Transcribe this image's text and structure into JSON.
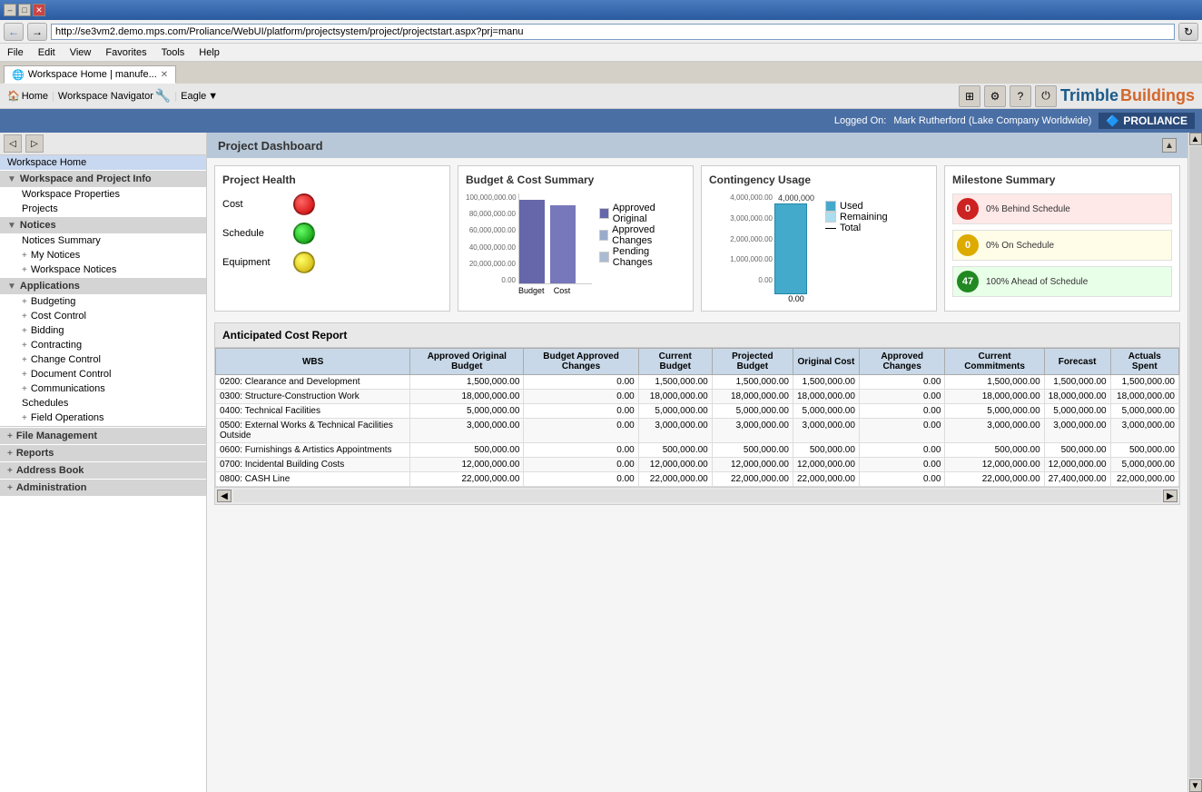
{
  "browser": {
    "url": "http://se3vm2.demo.mps.com/Proliance/WebUI/platform/projectsystem/project/projectstart.aspx?prj=manu",
    "tab_title": "Workspace Home | manufe...",
    "window_buttons": [
      "minimize",
      "maximize",
      "close"
    ],
    "menu_items": [
      "File",
      "Edit",
      "View",
      "Favorites",
      "Tools",
      "Help"
    ]
  },
  "app_header": {
    "home_label": "Home",
    "workspace_nav_label": "Workspace Navigator",
    "eagle_label": "Eagle",
    "logo": "Trimble Buildings"
  },
  "top_bar": {
    "logged_on_label": "Logged On:",
    "user": "Mark Rutherford (Lake Company Worldwide)",
    "proliance_label": "PROLIANCE"
  },
  "sidebar": {
    "header": "Workspace Home",
    "items": [
      {
        "id": "workspace-home",
        "label": "Workspace Home",
        "level": 0,
        "type": "header"
      },
      {
        "id": "workspace-project-info",
        "label": "Workspace and Project Info",
        "level": 0,
        "type": "section",
        "expanded": true
      },
      {
        "id": "workspace-properties",
        "label": "Workspace Properties",
        "level": 1
      },
      {
        "id": "projects",
        "label": "Projects",
        "level": 1
      },
      {
        "id": "notices",
        "label": "Notices",
        "level": 0,
        "type": "section",
        "expanded": true
      },
      {
        "id": "notices-summary",
        "label": "Notices Summary",
        "level": 1
      },
      {
        "id": "my-notices",
        "label": "My Notices",
        "level": 1,
        "expandable": true
      },
      {
        "id": "workspace-notices",
        "label": "Workspace Notices",
        "level": 1,
        "expandable": true
      },
      {
        "id": "applications",
        "label": "Applications",
        "level": 0,
        "type": "section",
        "expanded": true
      },
      {
        "id": "budgeting",
        "label": "Budgeting",
        "level": 1,
        "expandable": true
      },
      {
        "id": "cost-control",
        "label": "Cost Control",
        "level": 1,
        "expandable": true
      },
      {
        "id": "bidding",
        "label": "Bidding",
        "level": 1,
        "expandable": true
      },
      {
        "id": "contracting",
        "label": "Contracting",
        "level": 1,
        "expandable": true
      },
      {
        "id": "change-control",
        "label": "Change Control",
        "level": 1,
        "expandable": true
      },
      {
        "id": "document-control",
        "label": "Document Control",
        "level": 1,
        "expandable": true
      },
      {
        "id": "communications",
        "label": "Communications",
        "level": 1,
        "expandable": true
      },
      {
        "id": "schedules",
        "label": "Schedules",
        "level": 1
      },
      {
        "id": "field-operations",
        "label": "Field Operations",
        "level": 1,
        "expandable": true
      },
      {
        "id": "file-management",
        "label": "File Management",
        "level": 0,
        "type": "section",
        "expandable": true
      },
      {
        "id": "reports",
        "label": "Reports",
        "level": 0,
        "type": "section",
        "expandable": true
      },
      {
        "id": "address-book",
        "label": "Address Book",
        "level": 0,
        "type": "section",
        "expandable": true
      },
      {
        "id": "administration",
        "label": "Administration",
        "level": 0,
        "type": "section",
        "expandable": true
      }
    ]
  },
  "content": {
    "title": "Project Dashboard",
    "project_health": {
      "title": "Project Health",
      "rows": [
        {
          "label": "Cost",
          "status": "red"
        },
        {
          "label": "Schedule",
          "status": "green"
        },
        {
          "label": "Equipment",
          "status": "yellow"
        }
      ]
    },
    "budget_chart": {
      "title": "Budget & Cost Summary",
      "y_labels": [
        "100,000,000.00",
        "80,000,000.00",
        "60,000,000.00",
        "40,000,000.00",
        "20,000,000.00",
        "0.00"
      ],
      "x_labels": [
        "Budget",
        "Cost"
      ],
      "bars": [
        {
          "label": "Budget",
          "segments": [
            {
              "type": "approved_original",
              "height": 92,
              "color": "#6666aa"
            },
            {
              "type": "approved_changes",
              "height": 4,
              "color": "#99aacc"
            },
            {
              "type": "pending_changes",
              "height": 2,
              "color": "#aabbd4"
            }
          ]
        },
        {
          "label": "Cost",
          "segments": [
            {
              "type": "approved_original",
              "height": 88,
              "color": "#6666aa"
            }
          ]
        }
      ],
      "legend": [
        "Approved Original",
        "Approved Changes",
        "Pending Changes"
      ],
      "legend_colors": [
        "#6666aa",
        "#99aacc",
        "#aabbd4"
      ]
    },
    "contingency_chart": {
      "title": "Contingency Usage",
      "y_labels": [
        "4,000,000.00",
        "3,000,000.00",
        "2,000,000.00",
        "1,000,000.00",
        "0.00"
      ],
      "top_label": "4,000,000",
      "bar_used_height": 100,
      "bar_remaining_height": 0,
      "legend": [
        "Used",
        "Remaining",
        "Total"
      ],
      "legend_colors": [
        "#44aacc",
        "#aaddee",
        "#000000"
      ]
    },
    "milestone_summary": {
      "title": "Milestone Summary",
      "rows": [
        {
          "count": 0,
          "status": "red",
          "label": "0% Behind Schedule",
          "bg": "red"
        },
        {
          "count": 0,
          "status": "yellow",
          "label": "0% On Schedule",
          "bg": "yellow"
        },
        {
          "count": 47,
          "status": "green",
          "label": "100% Ahead of Schedule",
          "bg": "green"
        }
      ]
    },
    "table": {
      "title": "Anticipated Cost Report",
      "columns": [
        "WBS",
        "Approved Original Budget",
        "Budget Approved Changes",
        "Current Budget",
        "Projected Budget",
        "Original Cost",
        "Approved Changes",
        "Current Commitments",
        "Forecast",
        "Actuals Spent"
      ],
      "rows": [
        {
          "wbs": "0200: Clearance and Development",
          "approved_original": "1,500,000.00",
          "budget_approved": "0.00",
          "current_budget": "1,500,000.00",
          "projected_budget": "1,500,000.00",
          "original_cost": "1,500,000.00",
          "approved_changes": "0.00",
          "current_commitments": "1,500,000.00",
          "forecast": "1,500,000.00",
          "actuals_spent": "1,500,000.00"
        },
        {
          "wbs": "0300: Structure-Construction Work",
          "approved_original": "18,000,000.00",
          "budget_approved": "0.00",
          "current_budget": "18,000,000.00",
          "projected_budget": "18,000,000.00",
          "original_cost": "18,000,000.00",
          "approved_changes": "0.00",
          "current_commitments": "18,000,000.00",
          "forecast": "18,000,000.00",
          "actuals_spent": "18,000,000.00"
        },
        {
          "wbs": "0400: Technical Facilities",
          "approved_original": "5,000,000.00",
          "budget_approved": "0.00",
          "current_budget": "5,000,000.00",
          "projected_budget": "5,000,000.00",
          "original_cost": "5,000,000.00",
          "approved_changes": "0.00",
          "current_commitments": "5,000,000.00",
          "forecast": "5,000,000.00",
          "actuals_spent": "5,000,000.00"
        },
        {
          "wbs": "0500: External Works & Technical Facilities Outside",
          "approved_original": "3,000,000.00",
          "budget_approved": "0.00",
          "current_budget": "3,000,000.00",
          "projected_budget": "3,000,000.00",
          "original_cost": "3,000,000.00",
          "approved_changes": "0.00",
          "current_commitments": "3,000,000.00",
          "forecast": "3,000,000.00",
          "actuals_spent": "3,000,000.00"
        },
        {
          "wbs": "0600: Furnishings & Artistics Appointments",
          "approved_original": "500,000.00",
          "budget_approved": "0.00",
          "current_budget": "500,000.00",
          "projected_budget": "500,000.00",
          "original_cost": "500,000.00",
          "approved_changes": "0.00",
          "current_commitments": "500,000.00",
          "forecast": "500,000.00",
          "actuals_spent": "500,000.00"
        },
        {
          "wbs": "0700: Incidental Building Costs",
          "approved_original": "12,000,000.00",
          "budget_approved": "0.00",
          "current_budget": "12,000,000.00",
          "projected_budget": "12,000,000.00",
          "original_cost": "12,000,000.00",
          "approved_changes": "0.00",
          "current_commitments": "12,000,000.00",
          "forecast": "12,000,000.00",
          "actuals_spent": "5,000,000.00"
        },
        {
          "wbs": "0800: CASH Line",
          "approved_original": "22,000,000.00",
          "budget_approved": "0.00",
          "current_budget": "22,000,000.00",
          "projected_budget": "22,000,000.00",
          "original_cost": "22,000,000.00",
          "approved_changes": "0.00",
          "current_commitments": "22,000,000.00",
          "forecast": "27,400,000.00",
          "actuals_spent": "22,000,000.00"
        }
      ]
    }
  }
}
